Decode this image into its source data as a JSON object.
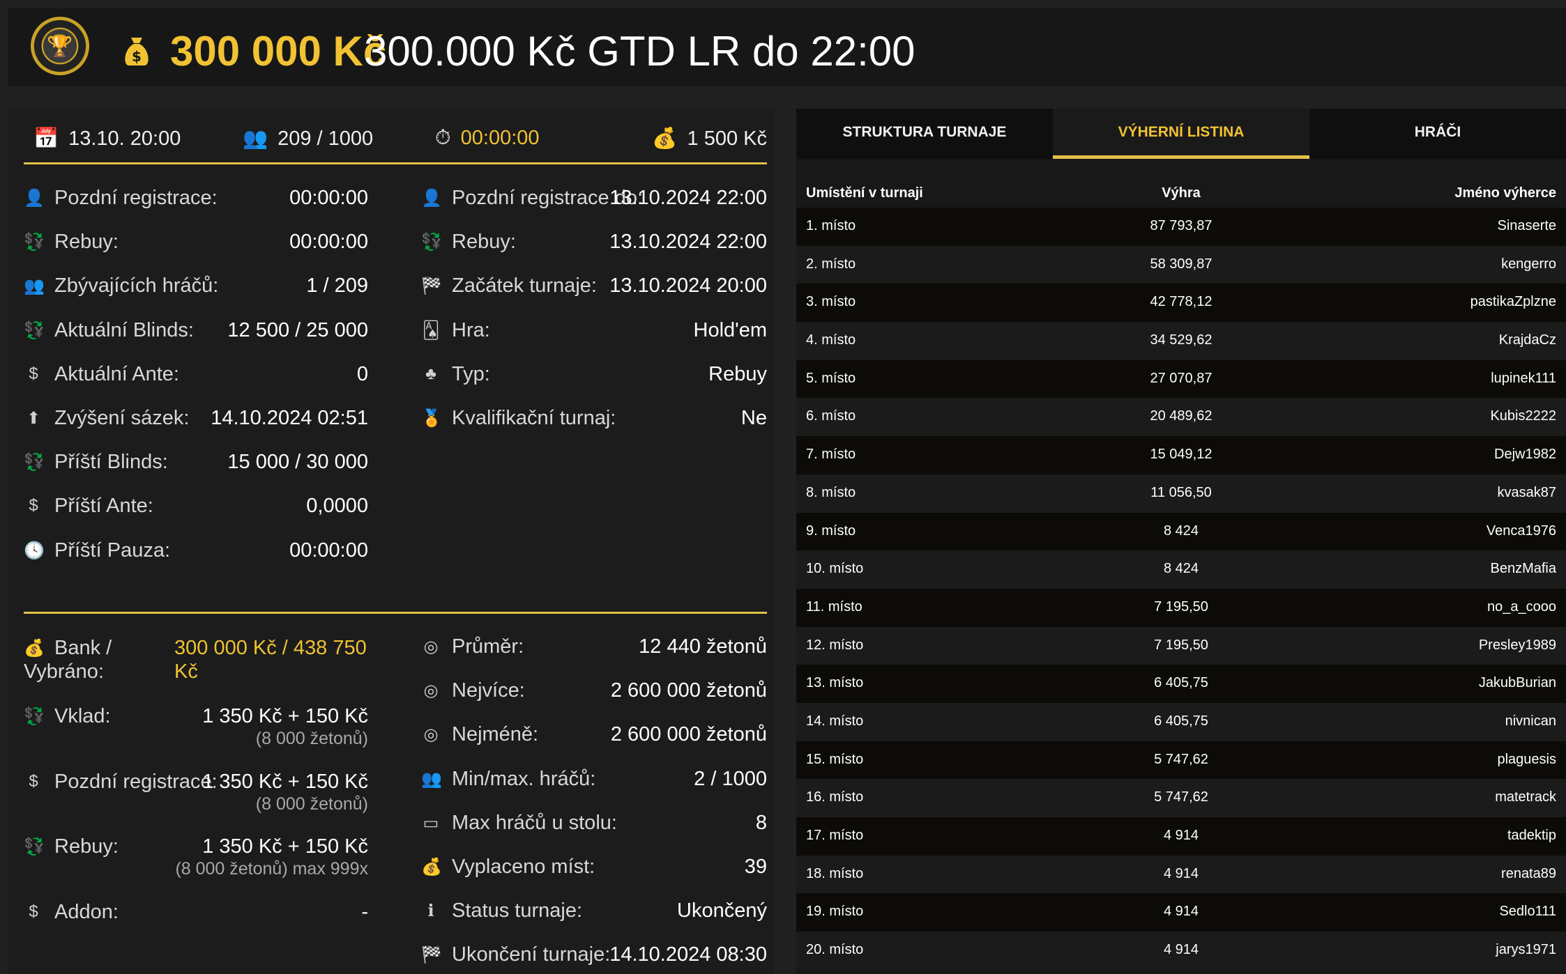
{
  "header": {
    "amount": "300 000 Kč",
    "title": "300.000 Kč GTD LR do 22:00"
  },
  "topbar": {
    "date": "13.10. 20:00",
    "players": "209 / 1000",
    "timer": "00:00:00",
    "buyin": "1 500 Kč"
  },
  "info_left": [
    {
      "icon": "person-plus-icon",
      "label": "Pozdní registrace:",
      "value": "00:00:00"
    },
    {
      "icon": "rebuy-icon",
      "label": "Rebuy:",
      "value": "00:00:00"
    },
    {
      "icon": "users-icon",
      "label": "Zbývajících hráčů:",
      "value": "1 / 209"
    },
    {
      "icon": "rebuy-icon",
      "label": "Aktuální Blinds:",
      "value": "12 500 / 25 000"
    },
    {
      "icon": "coin-icon",
      "label": "Aktuální Ante:",
      "value": "0"
    },
    {
      "icon": "arrow-up-icon",
      "label": "Zvýšení sázek:",
      "value": "14.10.2024 02:51"
    },
    {
      "icon": "rebuy-icon",
      "label": "Příští Blinds:",
      "value": "15 000 / 30 000"
    },
    {
      "icon": "coin-icon",
      "label": "Příští Ante:",
      "value": "0,0000"
    },
    {
      "icon": "clock-icon",
      "label": "Příští Pauza:",
      "value": "00:00:00"
    }
  ],
  "info_right": [
    {
      "icon": "person-plus-icon",
      "label": "Pozdní registrace do:",
      "value": "13.10.2024 22:00"
    },
    {
      "icon": "rebuy-icon",
      "label": "Rebuy:",
      "value": "13.10.2024 22:00"
    },
    {
      "icon": "flag-icon",
      "label": "Začátek turnaje:",
      "value": "13.10.2024 20:00"
    },
    {
      "icon": "cards-icon",
      "label": "Hra:",
      "value": "Hold'em"
    },
    {
      "icon": "suits-icon",
      "label": "Typ:",
      "value": "Rebuy"
    },
    {
      "icon": "medal-icon",
      "label": "Kvalifikační turnaj:",
      "value": "Ne"
    }
  ],
  "bank": {
    "label_line1": "Bank /",
    "label_line2": "Vybráno:",
    "value_line1": "300 000 Kč / 438 750",
    "value_line2": "Kč"
  },
  "fees_left": [
    {
      "icon": "rebuy-icon",
      "label": "Vklad:",
      "value": "1 350 Kč + 150 Kč",
      "sub": "(8 000 žetonů)"
    },
    {
      "icon": "coin-icon",
      "label": "Pozdní registrace:",
      "value": "1 350 Kč + 150 Kč",
      "sub": "(8 000 žetonů)"
    },
    {
      "icon": "rebuy-icon",
      "label": "Rebuy:",
      "value": "1 350 Kč + 150 Kč",
      "sub": "(8 000 žetonů) max 999x"
    },
    {
      "icon": "coin-icon",
      "label": "Addon:",
      "value": "-",
      "sub": ""
    }
  ],
  "fees_right": [
    {
      "icon": "chip-icon",
      "label": "Průměr:",
      "value": "12 440 žetonů"
    },
    {
      "icon": "chip-icon",
      "label": "Nejvíce:",
      "value": "2 600 000 žetonů"
    },
    {
      "icon": "chip-icon",
      "label": "Nejméně:",
      "value": "2 600 000 žetonů"
    },
    {
      "icon": "users-icon",
      "label": "Min/max. hráčů:",
      "value": "2 / 1000"
    },
    {
      "icon": "table-icon",
      "label": "Max hráčů u stolu:",
      "value": "8"
    },
    {
      "icon": "payout-icon",
      "label": "Vyplaceno míst:",
      "value": "39"
    },
    {
      "icon": "info-icon",
      "label": "Status turnaje:",
      "value": "Ukončený"
    },
    {
      "icon": "flag-icon",
      "label": "Ukončení turnaje:",
      "value": "14.10.2024 08:30"
    }
  ],
  "tabs": [
    "STRUKTURA TURNAJE",
    "VÝHERNÍ LISTINA",
    "HRÁČI"
  ],
  "table": {
    "headers": [
      "Umístění v turnaji",
      "Výhra",
      "Jméno výherce"
    ],
    "rows": [
      [
        "1. místo",
        "87 793,87",
        "Sinaserte"
      ],
      [
        "2. místo",
        "58 309,87",
        "kengerro"
      ],
      [
        "3. místo",
        "42 778,12",
        "pastikaZplzne"
      ],
      [
        "4. místo",
        "34 529,62",
        "KrajdaCz"
      ],
      [
        "5. místo",
        "27 070,87",
        "lupinek111"
      ],
      [
        "6. místo",
        "20 489,62",
        "Kubis2222"
      ],
      [
        "7. místo",
        "15 049,12",
        "Dejw1982"
      ],
      [
        "8. místo",
        "11 056,50",
        "kvasak87"
      ],
      [
        "9. místo",
        "8 424",
        "Venca1976"
      ],
      [
        "10. místo",
        "8 424",
        "BenzMafia"
      ],
      [
        "11. místo",
        "7 195,50",
        "no_a_cooo"
      ],
      [
        "12. místo",
        "7 195,50",
        "Presley1989"
      ],
      [
        "13. místo",
        "6 405,75",
        "JakubBurian"
      ],
      [
        "14. místo",
        "6 405,75",
        "nivnican"
      ],
      [
        "15. místo",
        "5 747,62",
        "plaguesis"
      ],
      [
        "16. místo",
        "5 747,62",
        "matetrack"
      ],
      [
        "17. místo",
        "4 914",
        "tadektip"
      ],
      [
        "18. místo",
        "4 914",
        "renata89"
      ],
      [
        "19. místo",
        "4 914",
        "Sedlo111"
      ],
      [
        "20. místo",
        "4 914",
        "jarys1971"
      ]
    ]
  },
  "colors": {
    "accent": "#e3c14a",
    "gold": "#f1c232",
    "background": "#202020"
  }
}
